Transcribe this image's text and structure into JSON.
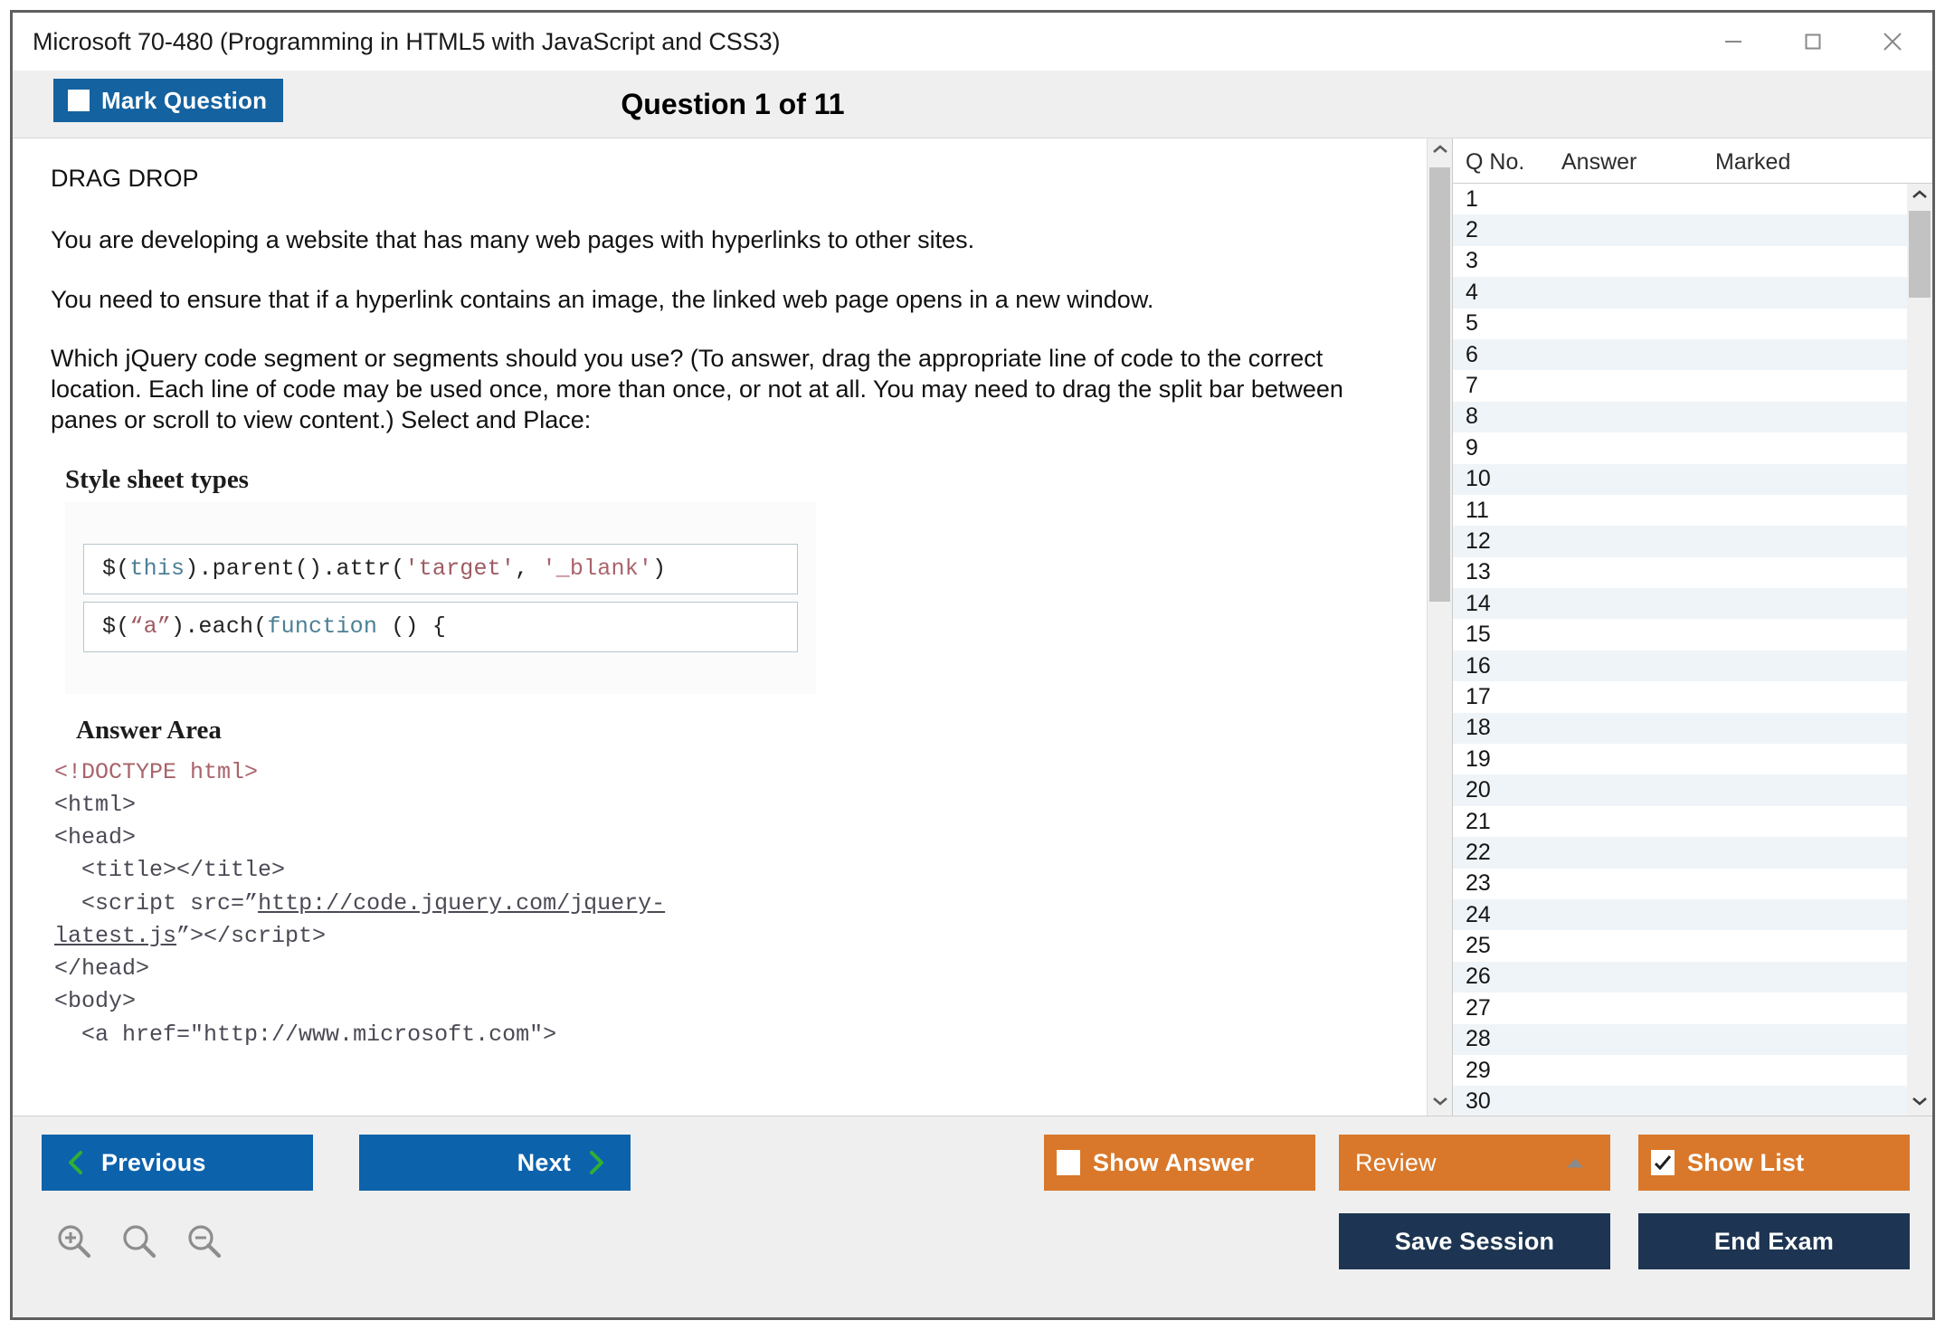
{
  "window": {
    "title": "Microsoft 70-480 (Programming in HTML5 with JavaScript and CSS3)",
    "controls": {
      "minimize": "minimize-icon",
      "maximize": "maximize-icon",
      "close": "close-icon"
    }
  },
  "header": {
    "mark_question_label": "Mark Question",
    "question_title": "Question 1 of 11"
  },
  "question": {
    "type_label": "DRAG DROP",
    "paragraphs": [
      "You are developing a website that has many web pages with hyperlinks to other sites.",
      "You need to ensure that if a hyperlink contains an image, the linked web page opens in a new window.",
      "Which jQuery code segment or segments should you use? (To answer, drag the appropriate line of code to the correct location. Each line of code may be used once, more than once, or not at all. You may need to drag the split bar between panes or scroll to view content.) Select and Place:"
    ],
    "exhibit": {
      "source_title": "Style sheet types",
      "drag_items": [
        "$(this).parent().attr('target', '_blank')",
        "$(\"a\").each(function () {"
      ],
      "answer_area_title": "Answer Area",
      "answer_code_lines": [
        "<!DOCTYPE html>",
        "<html>",
        "<head>",
        "  <title></title>",
        "  <script src=\"http://code.jquery.com/jquery-latest.js\"></script>",
        "</head>",
        "<body>",
        "  <a href=\"http://www.microsoft.com\">"
      ]
    }
  },
  "question_list": {
    "columns": [
      "Q No.",
      "Answer",
      "Marked"
    ],
    "rows": [
      {
        "no": "1",
        "answer": "",
        "marked": ""
      },
      {
        "no": "2",
        "answer": "",
        "marked": ""
      },
      {
        "no": "3",
        "answer": "",
        "marked": ""
      },
      {
        "no": "4",
        "answer": "",
        "marked": ""
      },
      {
        "no": "5",
        "answer": "",
        "marked": ""
      },
      {
        "no": "6",
        "answer": "",
        "marked": ""
      },
      {
        "no": "7",
        "answer": "",
        "marked": ""
      },
      {
        "no": "8",
        "answer": "",
        "marked": ""
      },
      {
        "no": "9",
        "answer": "",
        "marked": ""
      },
      {
        "no": "10",
        "answer": "",
        "marked": ""
      },
      {
        "no": "11",
        "answer": "",
        "marked": ""
      },
      {
        "no": "12",
        "answer": "",
        "marked": ""
      },
      {
        "no": "13",
        "answer": "",
        "marked": ""
      },
      {
        "no": "14",
        "answer": "",
        "marked": ""
      },
      {
        "no": "15",
        "answer": "",
        "marked": ""
      },
      {
        "no": "16",
        "answer": "",
        "marked": ""
      },
      {
        "no": "17",
        "answer": "",
        "marked": ""
      },
      {
        "no": "18",
        "answer": "",
        "marked": ""
      },
      {
        "no": "19",
        "answer": "",
        "marked": ""
      },
      {
        "no": "20",
        "answer": "",
        "marked": ""
      },
      {
        "no": "21",
        "answer": "",
        "marked": ""
      },
      {
        "no": "22",
        "answer": "",
        "marked": ""
      },
      {
        "no": "23",
        "answer": "",
        "marked": ""
      },
      {
        "no": "24",
        "answer": "",
        "marked": ""
      },
      {
        "no": "25",
        "answer": "",
        "marked": ""
      },
      {
        "no": "26",
        "answer": "",
        "marked": ""
      },
      {
        "no": "27",
        "answer": "",
        "marked": ""
      },
      {
        "no": "28",
        "answer": "",
        "marked": ""
      },
      {
        "no": "29",
        "answer": "",
        "marked": ""
      },
      {
        "no": "30",
        "answer": "",
        "marked": ""
      }
    ]
  },
  "footer": {
    "previous_label": "Previous",
    "next_label": "Next",
    "show_answer_label": "Show Answer",
    "show_answer_checked": false,
    "review_label": "Review",
    "show_list_label": "Show List",
    "show_list_checked": true,
    "save_session_label": "Save Session",
    "end_exam_label": "End Exam",
    "zoom_icons": [
      "zoom-in-icon",
      "zoom-reset-icon",
      "zoom-out-icon"
    ]
  },
  "colors": {
    "primary_blue": "#0d62ac",
    "mark_blue": "#14629f",
    "orange": "#d9782a",
    "navy": "#1d3552",
    "chevron_green": "#2fb035",
    "row_alt": "#eff4f8",
    "panel_gray": "#efefef"
  }
}
